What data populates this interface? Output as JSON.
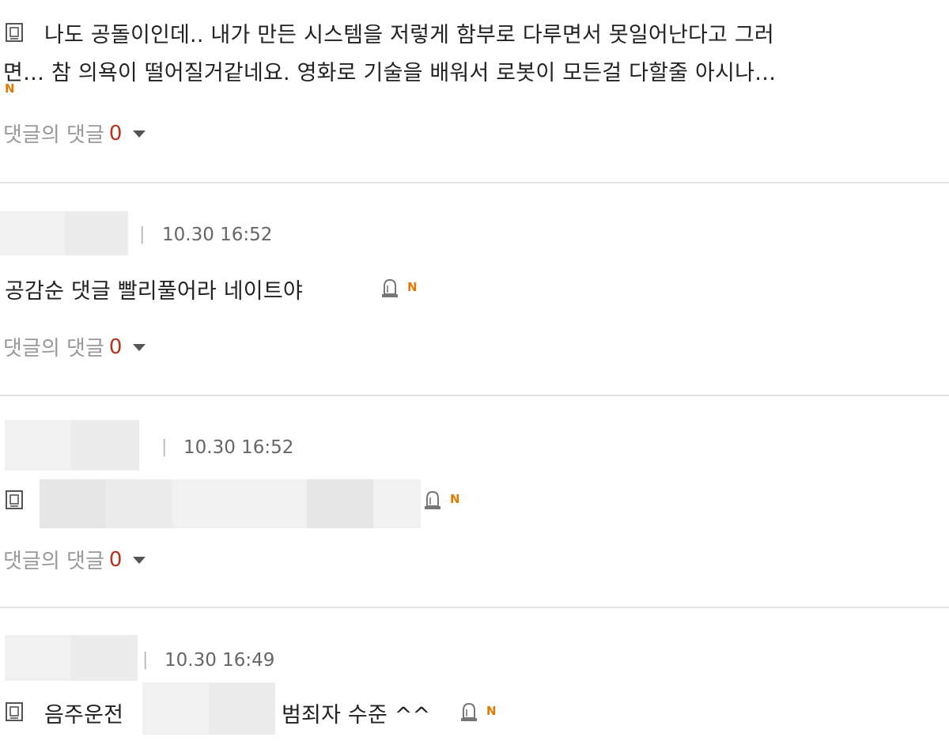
{
  "comments": [
    {
      "text_line1": "나도 공돌이인데.. 내가 만든 시스템을 저렇게 함부로 다루면서 못일어난다고 그러",
      "text_line2": "면… 참 의욕이 떨어질거같네요. 영화로 기술을 배워서 로봇이 모든걸 다할줄 아시나…",
      "new_badge": "N",
      "reply_label": "댓글의 댓글",
      "reply_count": "0"
    },
    {
      "timestamp": "10.30 16:52",
      "text": "공감순 댓글 빨리풀어라 네이트야",
      "new_badge": "N",
      "reply_label": "댓글의 댓글",
      "reply_count": "0"
    },
    {
      "timestamp": "10.30 16:52",
      "new_badge": "N",
      "reply_label": "댓글의 댓글",
      "reply_count": "0"
    },
    {
      "timestamp": "10.30 16:49",
      "text_before": "음주운전",
      "text_after": "범죄자 수준 ^^",
      "new_badge": "N"
    }
  ],
  "separator": "|",
  "colors": {
    "reply_count": "#b5321b",
    "new_badge": "#e07a00",
    "divider": "#e3e3e3",
    "muted_text": "#999999"
  },
  "icons": {
    "document": "document-icon",
    "report": "report-siren-icon",
    "expand": "caret-down-icon"
  }
}
